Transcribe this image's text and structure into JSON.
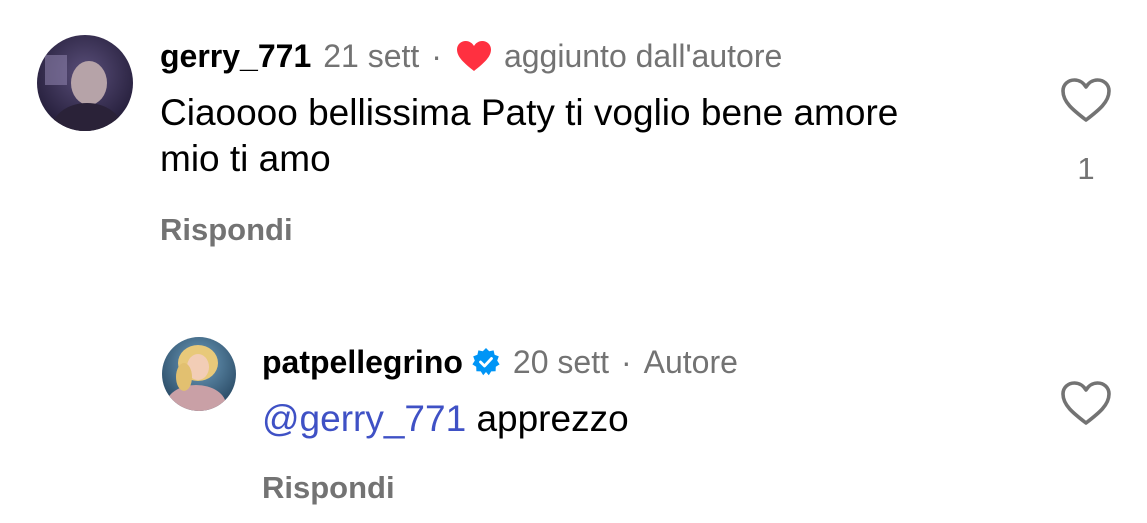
{
  "comments": [
    {
      "username": "gerry_771",
      "date": "21 sett",
      "separator": "·",
      "pinned_label": "aggiunto dall'autore",
      "text": "Ciaoooo bellissima Paty ti voglio bene amore mio ti amo",
      "reply_label": "Rispondi",
      "like_count": "1"
    },
    {
      "username": "patpellegrino",
      "date": "20 sett",
      "separator": "·",
      "author_label": "Autore",
      "mention": "@gerry_771",
      "text": "apprezzo",
      "reply_label": "Rispondi"
    }
  ],
  "colors": {
    "heart_red": "#ff3040",
    "secondary_grey": "#737373",
    "mention_blue": "#3f51c5",
    "verified_blue": "#0095f6"
  }
}
